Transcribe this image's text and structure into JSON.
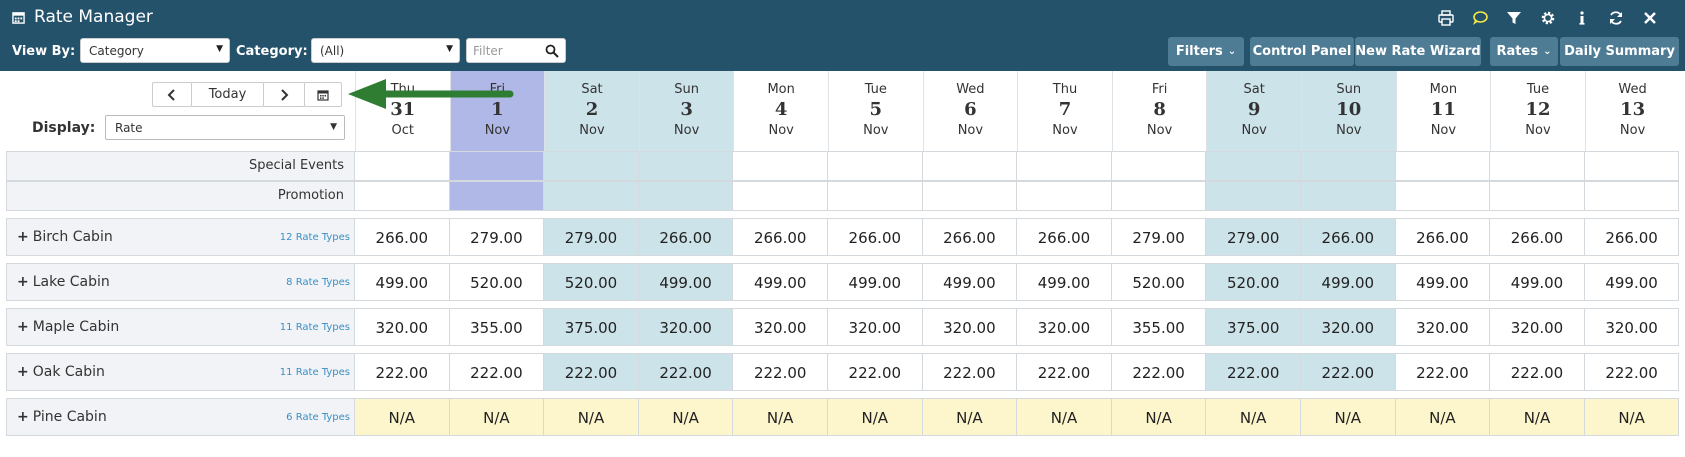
{
  "app": {
    "title": "Rate Manager"
  },
  "toolbar_icons": [
    "print-icon",
    "comment-icon",
    "filter-icon",
    "settings-icon",
    "info-icon",
    "refresh-icon",
    "close-icon"
  ],
  "filterbar": {
    "view_by_label": "View By:",
    "view_by_value": "Category",
    "category_label": "Category:",
    "category_value": "(All)",
    "filter_placeholder": "Filter",
    "buttons": {
      "filters": "Filters",
      "control_panel": "Control Panel",
      "new_rate_wizard": "New Rate Wizard",
      "rates": "Rates",
      "daily_summary": "Daily Summary"
    }
  },
  "nav": {
    "today": "Today"
  },
  "display": {
    "label": "Display:",
    "value": "Rate"
  },
  "days": [
    {
      "dow": "Thu",
      "day": "31",
      "month": "Oct",
      "type": "weekday"
    },
    {
      "dow": "Fri",
      "day": "1",
      "month": "Nov",
      "type": "today"
    },
    {
      "dow": "Sat",
      "day": "2",
      "month": "Nov",
      "type": "weekend"
    },
    {
      "dow": "Sun",
      "day": "3",
      "month": "Nov",
      "type": "weekend"
    },
    {
      "dow": "Mon",
      "day": "4",
      "month": "Nov",
      "type": "weekday"
    },
    {
      "dow": "Tue",
      "day": "5",
      "month": "Nov",
      "type": "weekday"
    },
    {
      "dow": "Wed",
      "day": "6",
      "month": "Nov",
      "type": "weekday"
    },
    {
      "dow": "Thu",
      "day": "7",
      "month": "Nov",
      "type": "weekday"
    },
    {
      "dow": "Fri",
      "day": "8",
      "month": "Nov",
      "type": "weekday"
    },
    {
      "dow": "Sat",
      "day": "9",
      "month": "Nov",
      "type": "weekend"
    },
    {
      "dow": "Sun",
      "day": "10",
      "month": "Nov",
      "type": "weekend"
    },
    {
      "dow": "Mon",
      "day": "11",
      "month": "Nov",
      "type": "weekday"
    },
    {
      "dow": "Tue",
      "day": "12",
      "month": "Nov",
      "type": "weekday"
    },
    {
      "dow": "Wed",
      "day": "13",
      "month": "Nov",
      "type": "weekday"
    }
  ],
  "event_rows": [
    "Special Events",
    "Promotion"
  ],
  "cabins": [
    {
      "name": "Birch Cabin",
      "types": "12 Rate Types",
      "rates": [
        "266.00",
        "279.00",
        "279.00",
        "266.00",
        "266.00",
        "266.00",
        "266.00",
        "266.00",
        "279.00",
        "279.00",
        "266.00",
        "266.00",
        "266.00",
        "266.00"
      ]
    },
    {
      "name": "Lake Cabin",
      "types": "8 Rate Types",
      "rates": [
        "499.00",
        "520.00",
        "520.00",
        "499.00",
        "499.00",
        "499.00",
        "499.00",
        "499.00",
        "520.00",
        "520.00",
        "499.00",
        "499.00",
        "499.00",
        "499.00"
      ]
    },
    {
      "name": "Maple Cabin",
      "types": "11 Rate Types",
      "rates": [
        "320.00",
        "355.00",
        "375.00",
        "320.00",
        "320.00",
        "320.00",
        "320.00",
        "320.00",
        "355.00",
        "375.00",
        "320.00",
        "320.00",
        "320.00",
        "320.00"
      ]
    },
    {
      "name": "Oak Cabin",
      "types": "11 Rate Types",
      "rates": [
        "222.00",
        "222.00",
        "222.00",
        "222.00",
        "222.00",
        "222.00",
        "222.00",
        "222.00",
        "222.00",
        "222.00",
        "222.00",
        "222.00",
        "222.00",
        "222.00"
      ]
    },
    {
      "name": "Pine Cabin",
      "types": "6 Rate Types",
      "rates": [
        "N/A",
        "N/A",
        "N/A",
        "N/A",
        "N/A",
        "N/A",
        "N/A",
        "N/A",
        "N/A",
        "N/A",
        "N/A",
        "N/A",
        "N/A",
        "N/A"
      ],
      "unavailable": true
    }
  ],
  "colors": {
    "header_bg": "#24526b",
    "button_bg": "#4f7c95",
    "today_bg": "#b0b8e8",
    "weekend_bg": "#cce3ea",
    "na_bg": "#fdf6cc",
    "label_bg": "#f1f3f6",
    "arrow": "#2e7d32",
    "link": "#3a8fc6"
  }
}
